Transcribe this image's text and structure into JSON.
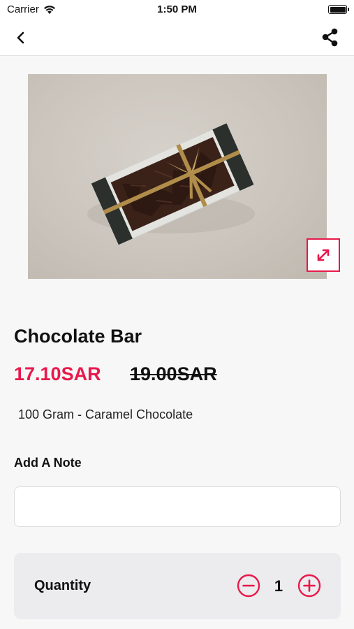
{
  "status_bar": {
    "carrier": "Carrier",
    "time": "1:50 PM",
    "icons": [
      "wifi-icon",
      "battery-icon"
    ]
  },
  "nav": {
    "back_icon": "chevron-left-icon",
    "share_icon": "share-icon"
  },
  "product": {
    "image_alt": "product-photo",
    "expand_icon": "expand-icon",
    "title": "Chocolate Bar",
    "price_current": "17.10SAR",
    "price_old": "19.00SAR",
    "description": "100 Gram - Caramel Chocolate"
  },
  "note": {
    "label": "Add A Note",
    "value": "",
    "placeholder": ""
  },
  "quantity": {
    "label": "Quantity",
    "value": "1",
    "minus_icon": "minus-circle-icon",
    "plus_icon": "plus-circle-icon"
  },
  "colors": {
    "accent": "#e8194b",
    "background": "#f7f7f8",
    "card": "#ececef"
  }
}
